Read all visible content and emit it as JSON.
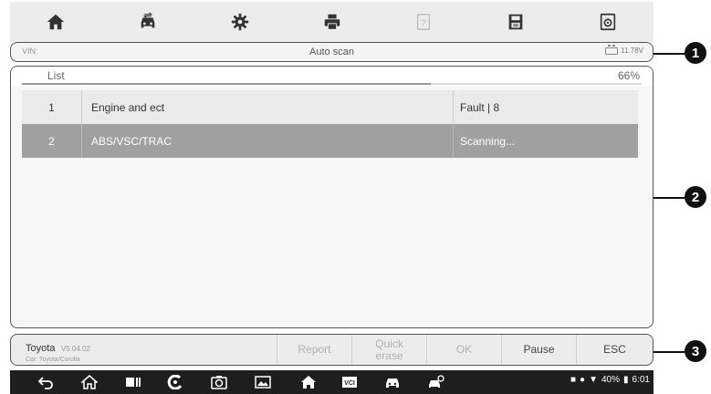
{
  "toolbar": {
    "icons": [
      "home-icon",
      "vehicle-swap-icon",
      "settings-gear-icon",
      "print-icon",
      "help-icon",
      "save-icon",
      "data-logging-icon"
    ]
  },
  "status": {
    "vin": "VIN:",
    "title": "Auto scan",
    "voltage": "11.78V"
  },
  "list": {
    "header": "List",
    "progress_percent": 66,
    "progress_label": "66%",
    "rows": [
      {
        "num": "1",
        "name": "Engine and ect",
        "status": "Fault | 8"
      },
      {
        "num": "2",
        "name": "ABS/VSC/TRAC",
        "status": "Scanning..."
      }
    ]
  },
  "bottom": {
    "make": "Toyota",
    "version": "V5.04.02",
    "car": "Car: Toyota/Corolla",
    "buttons": {
      "report": "Report",
      "quick_erase_1": "Quick",
      "quick_erase_2": "erase",
      "ok": "OK",
      "pause": "Pause",
      "esc": "ESC"
    }
  },
  "navbar": {
    "icons": [
      "back-icon",
      "home-icon",
      "recent-apps-icon",
      "chrome-icon",
      "camera-icon",
      "screenshot-icon",
      "app-home-icon",
      "vci-icon",
      "car-icon",
      "car-diagnose-icon"
    ],
    "battery": "40%",
    "time": "6:01"
  },
  "callouts": [
    "1",
    "2",
    "3"
  ],
  "colors": {
    "selected_row": "#a0a0a0",
    "navbar_bg": "#1e1e1e"
  }
}
